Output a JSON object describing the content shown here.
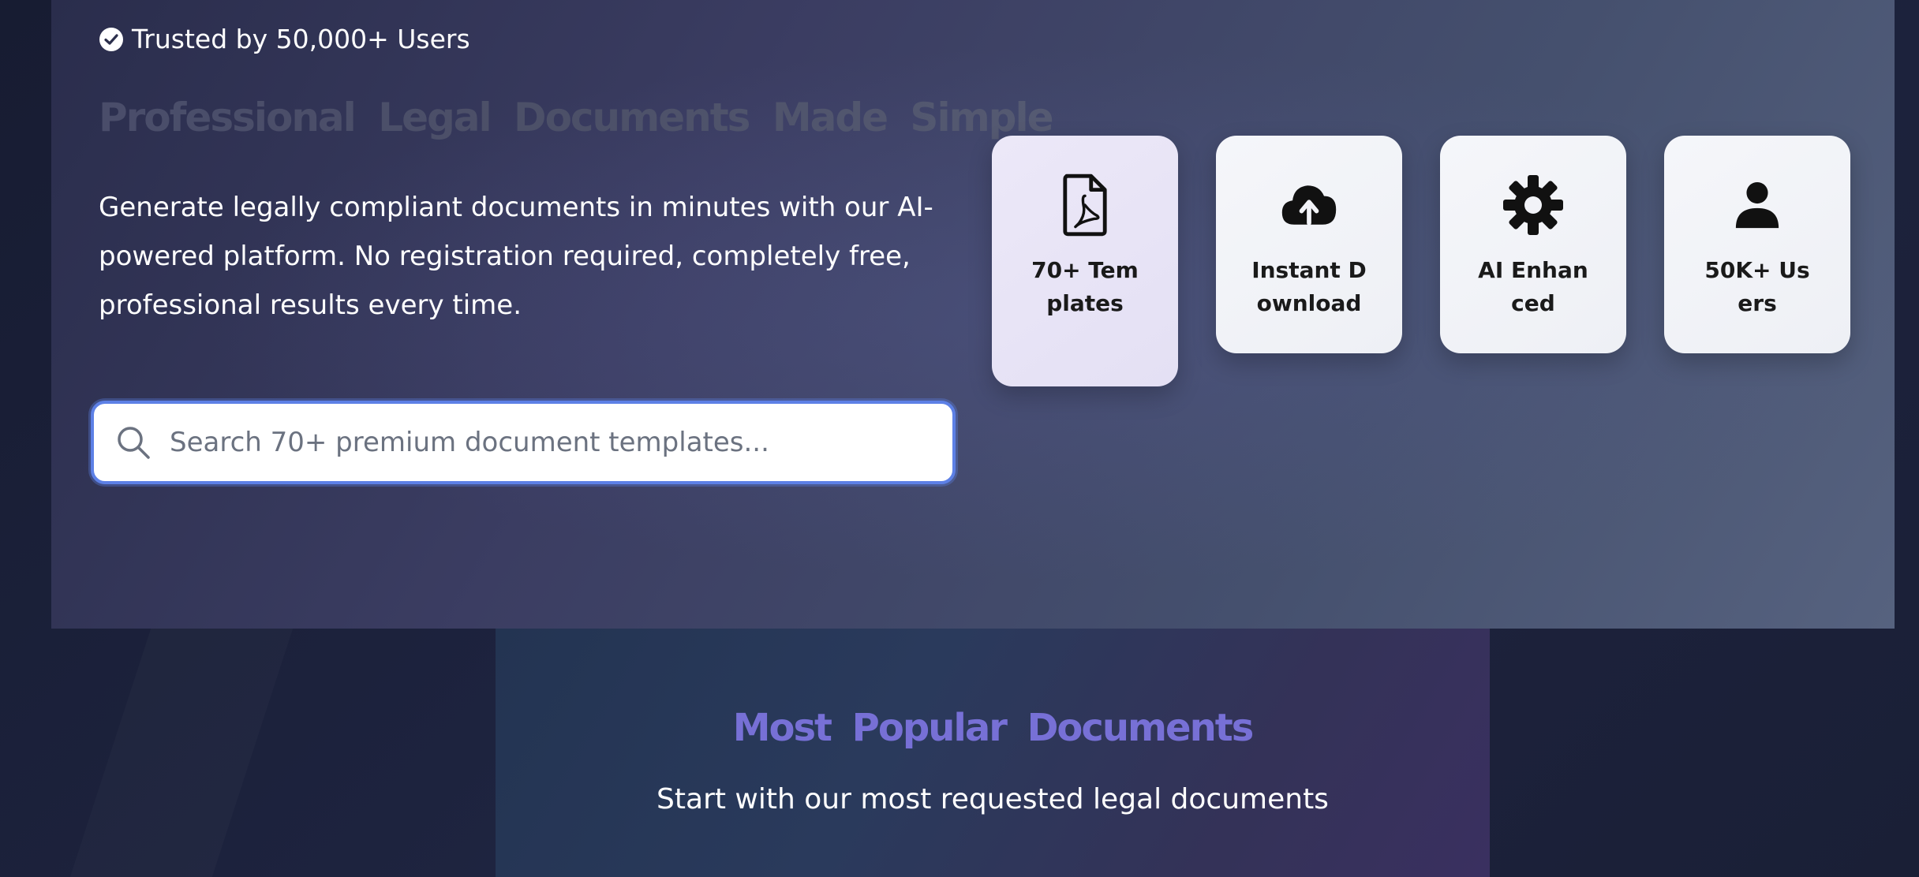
{
  "hero": {
    "trusted_text": "Trusted by 50,000+ Users",
    "title": "Professional Legal Documents Made Simple",
    "description": "Generate legally compliant documents in minutes with our AI-powered platform. No registration required, completely free, professional results every time."
  },
  "search": {
    "placeholder": "Search 70+ premium document templates...",
    "value": ""
  },
  "features": [
    {
      "label": "70+ Templates",
      "icon": "pdf-file-icon"
    },
    {
      "label": "Instant Download",
      "icon": "cloud-upload-icon"
    },
    {
      "label": "AI Enhanced",
      "icon": "gear-icon"
    },
    {
      "label": "50K+ Users",
      "icon": "user-icon"
    }
  ],
  "popular": {
    "title": "Most Popular Documents",
    "subtitle": "Start with our most requested legal documents"
  },
  "colors": {
    "accent": "#5d80e6",
    "section_title": "#7770d6",
    "card_bg": "#f2f3f8"
  }
}
